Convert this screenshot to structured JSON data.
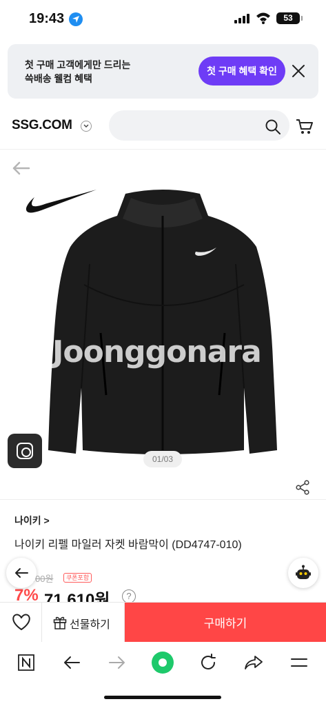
{
  "status_bar": {
    "time": "19:43",
    "battery": "53"
  },
  "promo": {
    "line1": "첫 구매 고객에게만 드리는",
    "line2": "쓱배송 웰컴 혜택",
    "cta_label": "첫 구매 혜택 확인"
  },
  "header": {
    "logo": "SSG.COM",
    "search_placeholder": ""
  },
  "product": {
    "watermark": "Joonggonara",
    "image_counter": "01/03",
    "brand": "나이키 >",
    "title": "나이키 리펠 마일러 자켓 바람막이 (DD4747-010)",
    "original_price": "…00원",
    "coupon_badge": "쿠폰포함",
    "discount": "7%",
    "price": "71,610원",
    "price_info": "?"
  },
  "purchase_bar": {
    "gift_label": "선물하기",
    "buy_label": "구매하기"
  },
  "colors": {
    "accent_purple": "#6e3cf6",
    "buy_red": "#ff4646",
    "discount_red": "#ff4b4b",
    "browser_green": "#1ec96b"
  },
  "browser_bar": {
    "icons": [
      "naver-n-icon",
      "back-arrow-icon",
      "forward-arrow-icon",
      "green-dot-icon",
      "refresh-icon",
      "share-arrow-icon",
      "menu-icon"
    ]
  }
}
